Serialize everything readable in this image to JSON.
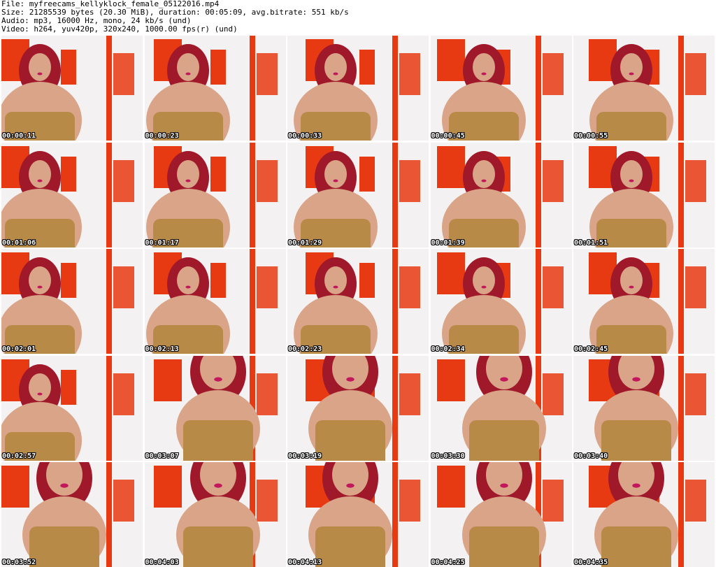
{
  "header": {
    "file_line": "File: myfreecams_kellyklock_female_05122016.mp4",
    "size_line": "Size: 21285539 bytes (20.30 MiB), duration: 00:05:09, avg.bitrate: 551 kb/s",
    "audio_line": "Audio: mp3, 16000 Hz, mono, 24 kb/s (und)",
    "video_line": "Video: h264, yuv420p, 320x240, 1000.00 fps(r) (und)"
  },
  "colors": {
    "wall": "#f3f1f1",
    "accent_orange": "#e83a12",
    "hair_red": "#a0192a",
    "skin": "#d9a488",
    "top_gold": "#b88a48"
  },
  "thumbnails": [
    {
      "timestamp": "00:00:11"
    },
    {
      "timestamp": "00:00:23"
    },
    {
      "timestamp": "00:00:33"
    },
    {
      "timestamp": "00:00:45"
    },
    {
      "timestamp": "00:00:55"
    },
    {
      "timestamp": "00:01:06"
    },
    {
      "timestamp": "00:01:17"
    },
    {
      "timestamp": "00:01:29"
    },
    {
      "timestamp": "00:01:39"
    },
    {
      "timestamp": "00:01:51"
    },
    {
      "timestamp": "00:02:01"
    },
    {
      "timestamp": "00:02:13"
    },
    {
      "timestamp": "00:02:23"
    },
    {
      "timestamp": "00:02:34"
    },
    {
      "timestamp": "00:02:45"
    },
    {
      "timestamp": "00:02:57"
    },
    {
      "timestamp": "00:03:07"
    },
    {
      "timestamp": "00:03:19"
    },
    {
      "timestamp": "00:03:30"
    },
    {
      "timestamp": "00:03:40"
    },
    {
      "timestamp": "00:03:52"
    },
    {
      "timestamp": "00:04:03"
    },
    {
      "timestamp": "00:04:13"
    },
    {
      "timestamp": "00:04:25"
    },
    {
      "timestamp": "00:04:35"
    }
  ]
}
